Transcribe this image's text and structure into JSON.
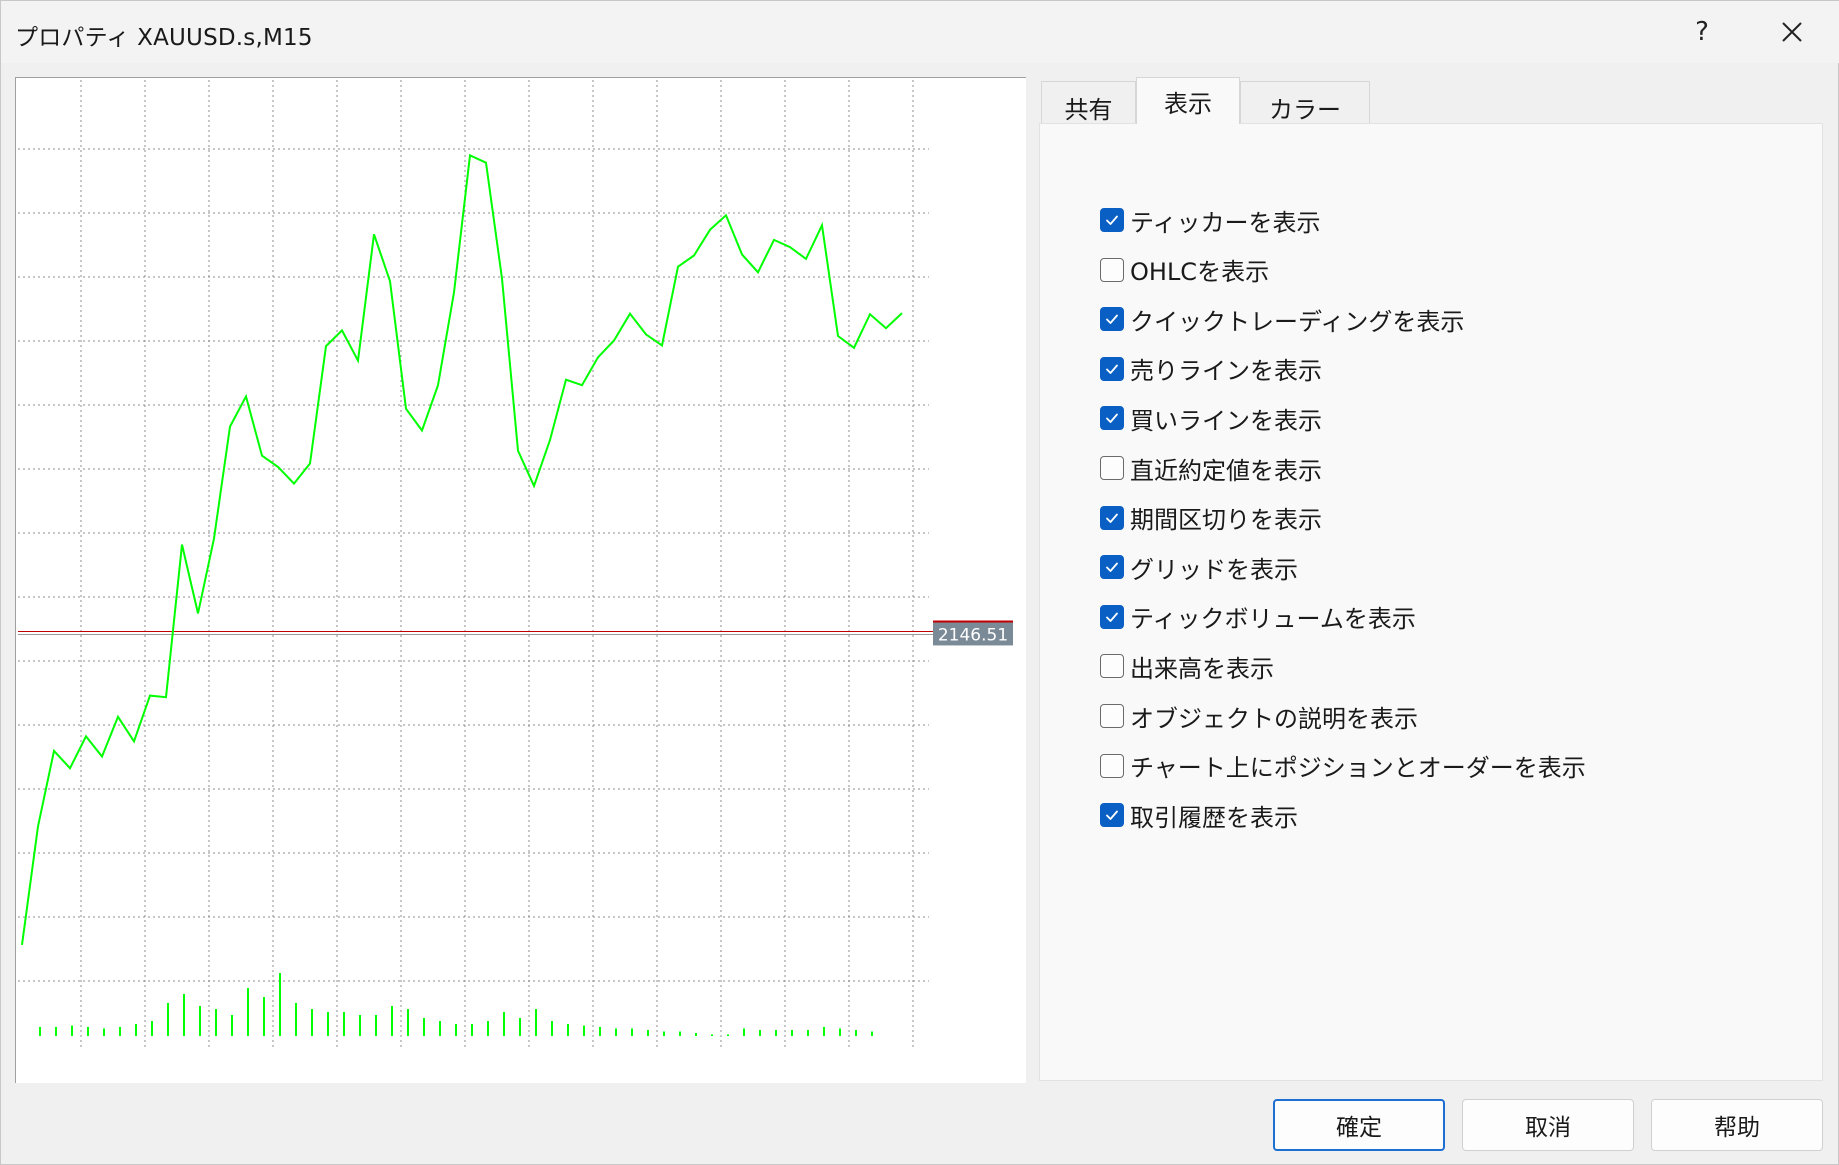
{
  "window": {
    "title": "プロパティ XAUUSD.s,M15",
    "help_glyph": "?",
    "close_icon": "close-icon"
  },
  "tabs": [
    {
      "label": "共有",
      "active": false
    },
    {
      "label": "表示",
      "active": true
    },
    {
      "label": "カラー",
      "active": false
    }
  ],
  "options": [
    {
      "label": "ティッカーを表示",
      "checked": true
    },
    {
      "label": "OHLCを表示",
      "checked": false
    },
    {
      "label": " クイックトレーディングを表示",
      "checked": true
    },
    {
      "label": "売りラインを表示",
      "checked": true
    },
    {
      "label": "買いラインを表示",
      "checked": true
    },
    {
      "label": "直近約定値を表示",
      "checked": false
    },
    {
      "label": "期間区切りを表示",
      "checked": true
    },
    {
      "label": "グリッドを表示",
      "checked": true
    },
    {
      "label": "ティックボリュームを表示",
      "checked": true
    },
    {
      "label": "出来高を表示",
      "checked": false
    },
    {
      "label": "オブジェクトの説明を表示",
      "checked": false
    },
    {
      "label": "チャート上にポジションとオーダーを表示",
      "checked": false
    },
    {
      "label": "取引履歴を表示",
      "checked": true
    }
  ],
  "buttons": {
    "ok": "確定",
    "cancel": "取消",
    "help": "帮助"
  },
  "colors": {
    "accent": "#0a5fc4",
    "line": "#00ff00",
    "volume": "#00ff00",
    "bid_line": "#c00000",
    "price_label_bg": "#7a8a96",
    "grid": "#8c8c8c"
  },
  "chart_data": {
    "type": "line",
    "price_label": "2146.51",
    "current_price": 2146.51,
    "grid": true,
    "series": [
      {
        "values": [
          2090.8,
          2112.0,
          2125.5,
          2122.4,
          2128.1,
          2124.5,
          2131.6,
          2127.2,
          2135.4,
          2135.1,
          2162.4,
          2150.1,
          2163.5,
          2183.5,
          2188.9,
          2178.3,
          2176.3,
          2173.3,
          2176.9,
          2197.9,
          2200.7,
          2195.3,
          2217.9,
          2209.5,
          2186.7,
          2182.8,
          2190.9,
          2207.5,
          2232.0,
          2230.7,
          2210.0,
          2179.2,
          2172.9,
          2181.1,
          2191.9,
          2190.9,
          2195.9,
          2198.9,
          2203.7,
          2200.0,
          2198.0,
          2212.1,
          2214.1,
          2218.7,
          2221.3,
          2214.3,
          2211.1,
          2216.9,
          2215.6,
          2213.5,
          2219.5,
          2199.7,
          2197.6,
          2203.6,
          2201.1,
          2203.8
        ]
      }
    ],
    "volume": [
      3,
      3,
      3.5,
      3,
      2.5,
      3,
      4,
      5,
      11,
      14,
      10,
      9,
      7,
      16,
      13,
      21,
      11,
      9,
      8,
      8,
      7,
      7,
      10,
      9,
      6,
      5,
      4,
      4,
      5,
      8,
      6,
      9,
      5,
      4,
      3.5,
      3,
      2.5,
      2.5,
      2,
      1.5,
      1.5,
      1,
      0.5,
      0.5,
      2.5,
      2,
      2,
      2,
      2,
      3,
      2.5,
      2,
      1.5,
      0,
      0,
      0
    ]
  }
}
